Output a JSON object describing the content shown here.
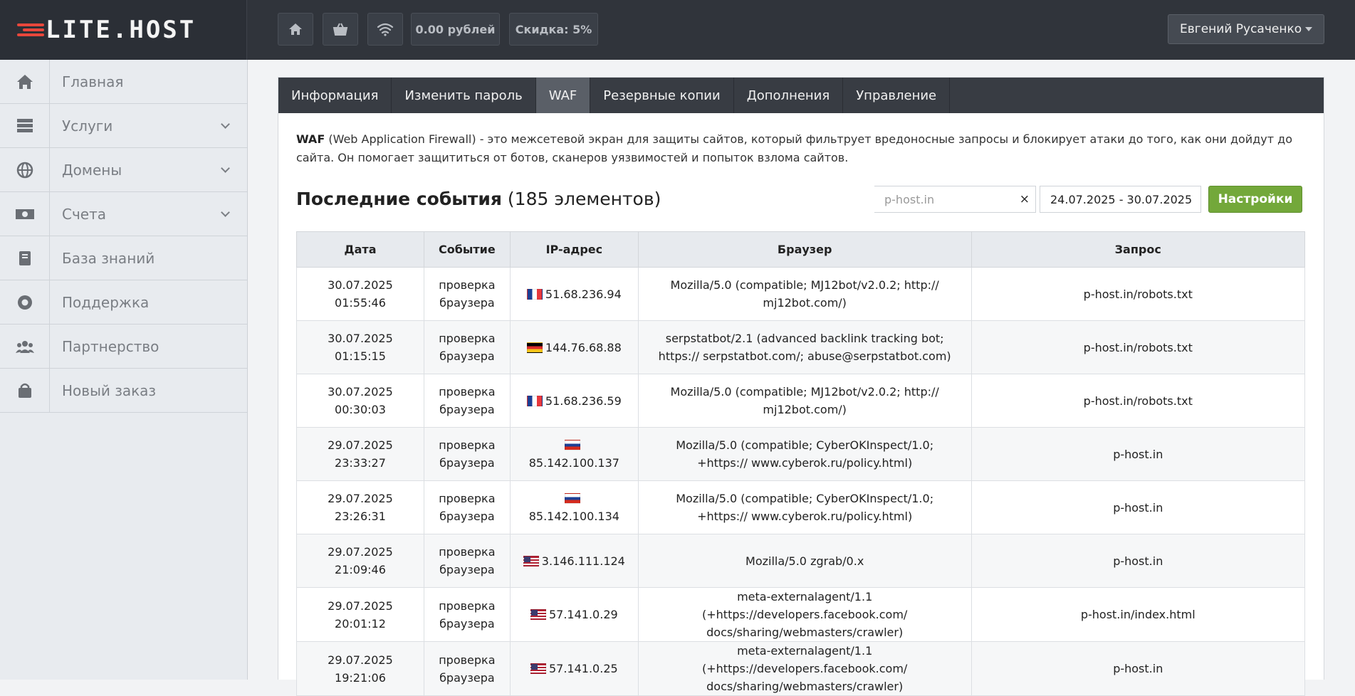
{
  "header": {
    "logo_text": "LITE.HOST",
    "balance": "0.00 рублей",
    "discount": "Скидка: 5%",
    "user_name": "Евгений Русаченко"
  },
  "sidebar": {
    "items": [
      {
        "label": "Главная",
        "icon": "home-icon",
        "has_submenu": false
      },
      {
        "label": "Услуги",
        "icon": "server-icon",
        "has_submenu": true
      },
      {
        "label": "Домены",
        "icon": "globe-icon",
        "has_submenu": true
      },
      {
        "label": "Счета",
        "icon": "money-icon",
        "has_submenu": true
      },
      {
        "label": "База знаний",
        "icon": "book-icon",
        "has_submenu": false
      },
      {
        "label": "Поддержка",
        "icon": "lifebuoy-icon",
        "has_submenu": false
      },
      {
        "label": "Партнерство",
        "icon": "users-icon",
        "has_submenu": false
      },
      {
        "label": "Новый заказ",
        "icon": "bag-icon",
        "has_submenu": false
      }
    ]
  },
  "tabs": [
    {
      "label": "Информация",
      "active": false
    },
    {
      "label": "Изменить пароль",
      "active": false
    },
    {
      "label": "WAF",
      "active": true
    },
    {
      "label": "Резервные копии",
      "active": false
    },
    {
      "label": "Дополнения",
      "active": false
    },
    {
      "label": "Управление",
      "active": false
    }
  ],
  "description": {
    "term": "WAF",
    "text": " (Web Application Firewall) - это межсетевой экран для защиты сайтов, который фильтрует вредоносные запросы и блокирует атаки до того, как они дойдут до сайта. Он помогает защититься от ботов, сканеров уязвимостей и попыток взлома сайтов."
  },
  "events": {
    "title": "Последние события",
    "count": "(185 элементов)",
    "domain_placeholder": "p-host.in",
    "clear_symbol": "×",
    "date_range": "24.07.2025 - 30.07.2025",
    "settings_label": "Настройки"
  },
  "table": {
    "headers": [
      "Дата",
      "Событие",
      "IP-адрес",
      "Браузер",
      "Запрос"
    ],
    "rows": [
      {
        "date": "30.07.2025 01:55:46",
        "event": "проверка браузера",
        "flag": "fr",
        "ip": "51.68.236.94",
        "browser": "Mozilla/5.0 (compatible; MJ12bot/v2.0.2; http:// mj12bot.com/)",
        "request": "p-host.in/robots.txt"
      },
      {
        "date": "30.07.2025 01:15:15",
        "event": "проверка браузера",
        "flag": "de",
        "ip": "144.76.68.88",
        "browser": "serpstatbot/2.1 (advanced backlink tracking bot; https:// serpstatbot.com/; abuse@serpstatbot.com)",
        "request": "p-host.in/robots.txt"
      },
      {
        "date": "30.07.2025 00:30:03",
        "event": "проверка браузера",
        "flag": "fr",
        "ip": "51.68.236.59",
        "browser": "Mozilla/5.0 (compatible; MJ12bot/v2.0.2; http:// mj12bot.com/)",
        "request": "p-host.in/robots.txt"
      },
      {
        "date": "29.07.2025 23:33:27",
        "event": "проверка браузера",
        "flag": "ru",
        "ip": "85.142.100.137",
        "browser": "Mozilla/5.0 (compatible; CyberOKInspect/1.0; +https:// www.cyberok.ru/policy.html)",
        "request": "p-host.in"
      },
      {
        "date": "29.07.2025 23:26:31",
        "event": "проверка браузера",
        "flag": "ru",
        "ip": "85.142.100.134",
        "browser": "Mozilla/5.0 (compatible; CyberOKInspect/1.0; +https:// www.cyberok.ru/policy.html)",
        "request": "p-host.in"
      },
      {
        "date": "29.07.2025 21:09:46",
        "event": "проверка браузера",
        "flag": "us",
        "ip": "3.146.111.124",
        "browser": "Mozilla/5.0 zgrab/0.x",
        "request": "p-host.in"
      },
      {
        "date": "29.07.2025 20:01:12",
        "event": "проверка браузера",
        "flag": "us",
        "ip": "57.141.0.29",
        "browser": "meta-externalagent/1.1 (+https://developers.facebook.com/ docs/sharing/webmasters/crawler)",
        "request": "p-host.in/index.html"
      },
      {
        "date": "29.07.2025 19:21:06",
        "event": "проверка браузера",
        "flag": "us",
        "ip": "57.141.0.25",
        "browser": "meta-externalagent/1.1 (+https://developers.facebook.com/ docs/sharing/webmasters/crawler)",
        "request": "p-host.in"
      }
    ]
  }
}
